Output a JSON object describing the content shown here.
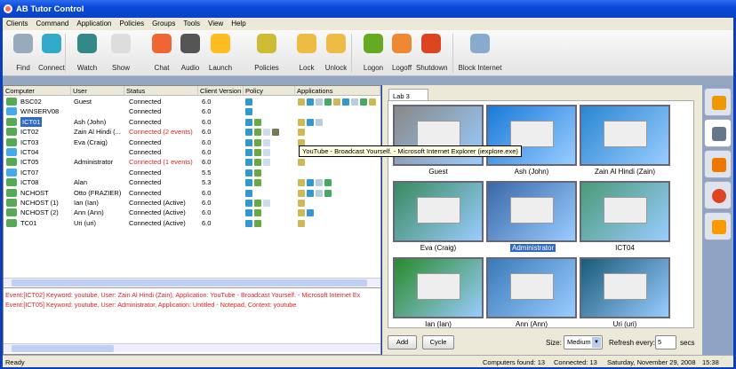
{
  "window": {
    "title": "AB Tutor Control"
  },
  "menu": [
    "Clients",
    "Command",
    "Application",
    "Policies",
    "Groups",
    "Tools",
    "View",
    "Help"
  ],
  "toolbar": [
    {
      "label": "Find",
      "icon": "magnifier-icon",
      "color": "#9ab"
    },
    {
      "label": "Connect",
      "icon": "wireless-icon",
      "color": "#3ac"
    },
    {
      "label": "Watch",
      "icon": "monitor-icon",
      "color": "#388"
    },
    {
      "label": "Show",
      "icon": "projector-screen-icon",
      "color": "#ddd"
    },
    {
      "label": "Chat",
      "icon": "chat-bubbles-icon",
      "color": "#e63"
    },
    {
      "label": "Audio",
      "icon": "speaker-icon",
      "color": "#555"
    },
    {
      "label": "Launch",
      "icon": "paper-plane-icon",
      "color": "#fb2"
    },
    {
      "label": "Policies",
      "icon": "shield-icon",
      "color": "#cb3"
    },
    {
      "label": "Lock",
      "icon": "lock-icon",
      "color": "#eb4"
    },
    {
      "label": "Unlock",
      "icon": "unlock-icon",
      "color": "#eb4"
    },
    {
      "label": "Logon",
      "icon": "check-circle-icon",
      "color": "#6a2"
    },
    {
      "label": "Logoff",
      "icon": "key-circle-icon",
      "color": "#e83"
    },
    {
      "label": "Shutdown",
      "icon": "power-icon",
      "color": "#d42"
    },
    {
      "label": "Block Internet",
      "icon": "block-internet-icon",
      "color": "#8ac"
    }
  ],
  "table": {
    "columns": [
      "Computer",
      "User",
      "Status",
      "Client Version",
      "Policy",
      "Applications"
    ],
    "rows": [
      {
        "computer": "BSC02",
        "user": "Guest",
        "status": "Connected",
        "version": "6.0",
        "policy": 1,
        "apps": 9,
        "alert": false
      },
      {
        "computer": "WINSERV08",
        "user": "",
        "status": "Connected",
        "version": "6.0",
        "policy": 1,
        "apps": 0,
        "alert": false
      },
      {
        "computer": "ICT01",
        "user": "Ash (John)",
        "status": "Connected",
        "version": "6.0",
        "policy": 2,
        "apps": 3,
        "alert": false,
        "selected": true
      },
      {
        "computer": "ICT02",
        "user": "Zain Al Hindi (...",
        "status": "Connected (2 events)",
        "version": "6.0",
        "policy": 4,
        "apps": 1,
        "alert": true
      },
      {
        "computer": "ICT03",
        "user": "Eva (Craig)",
        "status": "Connected",
        "version": "6.0",
        "policy": 3,
        "apps": 1,
        "alert": false
      },
      {
        "computer": "ICT04",
        "user": "",
        "status": "Connected",
        "version": "6.0",
        "policy": 3,
        "apps": 0,
        "alert": false
      },
      {
        "computer": "ICT05",
        "user": "Administrator",
        "status": "Connected (1 events)",
        "version": "6.0",
        "policy": 3,
        "apps": 1,
        "alert": true
      },
      {
        "computer": "ICT07",
        "user": "",
        "status": "Connected",
        "version": "5.5",
        "policy": 2,
        "apps": 0,
        "alert": false
      },
      {
        "computer": "ICT08",
        "user": "Alan",
        "status": "Connected",
        "version": "5.3",
        "policy": 2,
        "apps": 4,
        "alert": false
      },
      {
        "computer": "NCHOST",
        "user": "Otto (FRAZIER)",
        "status": "Connected",
        "version": "6.0",
        "policy": 1,
        "apps": 4,
        "alert": false
      },
      {
        "computer": "NCHOST (1)",
        "user": "Ian (Ian)",
        "status": "Connected (Active)",
        "version": "6.0",
        "policy": 3,
        "apps": 1,
        "alert": false
      },
      {
        "computer": "NCHOST (2)",
        "user": "Ann (Ann)",
        "status": "Connected (Active)",
        "version": "6.0",
        "policy": 2,
        "apps": 2,
        "alert": false
      },
      {
        "computer": "TC01",
        "user": "Uri (uri)",
        "status": "Connected (Active)",
        "version": "6.0",
        "policy": 2,
        "apps": 1,
        "alert": false
      }
    ]
  },
  "tooltip": "YouTube - Broadcast Yourself. - Microsoft Internet Explorer (iexplore.exe)",
  "events": [
    "Event:[ICT02] Keyword: youtube, User: Zain Al Hindi (Zain), Application: YouTube - Broadcast Yourself. - Microsoft Internet Ex",
    "Event:[ICT05] Keyword: youtube, User: Administrator, Application: Untitled - Notepad, Context: youtube"
  ],
  "thumbnails": {
    "tab": "Lab 3",
    "items": [
      {
        "label": "Guest",
        "bg": "#888"
      },
      {
        "label": "Ash (John)",
        "bg": "#1a7ad8"
      },
      {
        "label": "Zain Al Hindi (Zain)",
        "bg": "#2a86d0"
      },
      {
        "label": "Eva (Craig)",
        "bg": "#3a8a60"
      },
      {
        "label": "Administrator",
        "bg": "#3a68a8",
        "selected": true
      },
      {
        "label": "ICT04",
        "bg": "#4a9a78"
      },
      {
        "label": "Ian (Ian)",
        "bg": "#2a8a2a"
      },
      {
        "label": "Ann (Ann)",
        "bg": "#3a7ab8"
      },
      {
        "label": "Uri (uri)",
        "bg": "#1a5a78"
      }
    ]
  },
  "controls": {
    "add": "Add",
    "cycle": "Cycle",
    "size_label": "Size:",
    "size_value": "Medium",
    "refresh_label": "Refresh every:",
    "refresh_value": "5",
    "secs": "secs"
  },
  "side": [
    {
      "icon": "home-icon",
      "color": "#e90"
    },
    {
      "icon": "monitors-icon",
      "color": "#678"
    },
    {
      "icon": "bar-chart-icon",
      "color": "#e70"
    },
    {
      "icon": "block-icon",
      "color": "#d42"
    },
    {
      "icon": "settings-gear-icon",
      "color": "#f90"
    }
  ],
  "status": {
    "text": "Ready",
    "found": "Computers found: 13",
    "connected": "Connected: 13",
    "date": "Saturday, November 29, 2008",
    "time": "15:38"
  }
}
